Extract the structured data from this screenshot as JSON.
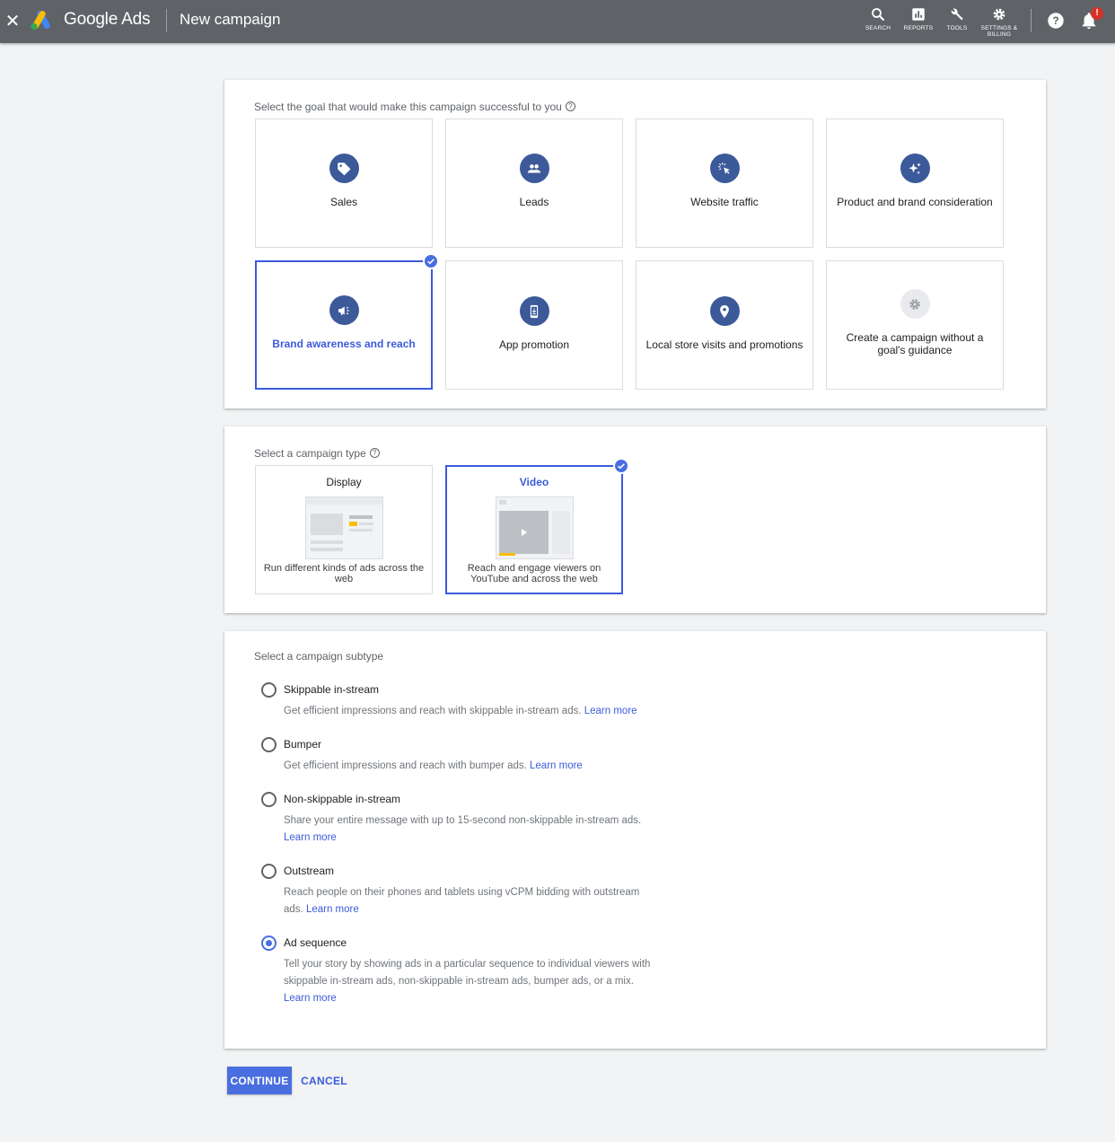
{
  "header": {
    "close_icon": "close-icon",
    "brand": "Google Ads",
    "page_title": "New campaign",
    "tools": [
      {
        "label": "SEARCH",
        "icon": "search-icon"
      },
      {
        "label": "REPORTS",
        "icon": "reports-icon"
      },
      {
        "label": "TOOLS",
        "icon": "wrench-icon"
      },
      {
        "label": "SETTINGS &\nBILLING",
        "icon": "gear-icon"
      }
    ],
    "help_icon": "help-icon",
    "notification_icon": "bell-icon",
    "notification_badge": "!"
  },
  "goals": {
    "label": "Select the goal that would make this campaign successful to you",
    "selected": "Brand awareness and reach",
    "items": [
      {
        "label": "Sales",
        "icon": "tag-icon"
      },
      {
        "label": "Leads",
        "icon": "people-icon"
      },
      {
        "label": "Website traffic",
        "icon": "cursor-click-icon"
      },
      {
        "label": "Product and brand consideration",
        "icon": "sparkle-icon"
      },
      {
        "label": "Brand awareness and reach",
        "icon": "megaphone-icon"
      },
      {
        "label": "App promotion",
        "icon": "phone-download-icon"
      },
      {
        "label": "Local store visits and promotions",
        "icon": "location-pin-icon"
      },
      {
        "label": "Create a campaign without a goal's guidance",
        "icon": "gear-icon"
      }
    ]
  },
  "campaign_type": {
    "label": "Select a campaign type",
    "selected": "Video",
    "items": [
      {
        "title": "Display",
        "description": "Run different kinds of ads across the web"
      },
      {
        "title": "Video",
        "description": "Reach and engage viewers on YouTube and across the web"
      }
    ]
  },
  "subtype": {
    "label": "Select a campaign subtype",
    "selected": "Ad sequence",
    "learn_more": "Learn more",
    "options": [
      {
        "name": "Skippable in-stream",
        "description": "Get efficient impressions and reach with skippable in-stream ads."
      },
      {
        "name": "Bumper",
        "description": "Get efficient impressions and reach with bumper ads."
      },
      {
        "name": "Non-skippable in-stream",
        "description": "Share your entire message with up to 15-second non-skippable in-stream ads."
      },
      {
        "name": "Outstream",
        "description": "Reach people on their phones and tablets using vCPM bidding with outstream ads."
      },
      {
        "name": "Ad sequence",
        "description": "Tell your story by showing ads in a particular sequence to individual viewers with skippable in-stream ads, non-skippable in-stream ads, bumper ads, or a mix."
      }
    ]
  },
  "actions": {
    "continue": "CONTINUE",
    "cancel": "CANCEL"
  },
  "colors": {
    "header_bg": "#5f6368",
    "accent": "#3b5bdb",
    "icon_circle": "#3c5a99",
    "page_bg": "#f1f3f4"
  }
}
